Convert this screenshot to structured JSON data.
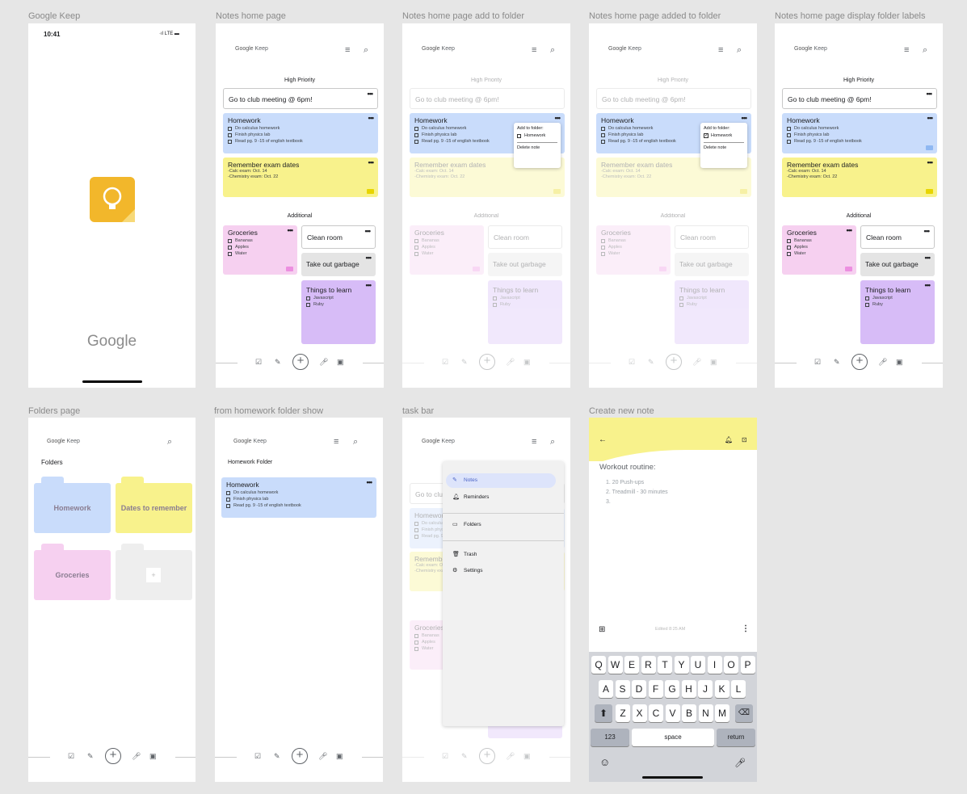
{
  "frame_labels": [
    "Google Keep",
    "Notes home page",
    "Notes home page add to folder",
    "Notes home page added to folder",
    "Notes home page display folder labels",
    "Folders page",
    "from homework folder show",
    "task bar",
    "Create new note"
  ],
  "splash": {
    "time": "10:41",
    "status": "LTE",
    "google": "Google"
  },
  "app": {
    "brand": "Google",
    "product": "Keep"
  },
  "sections": {
    "high": "High Priority",
    "additional": "Additional"
  },
  "notes": {
    "club": "Go to club meeting @ 6pm!",
    "homework_title": "Homework",
    "homework_items": [
      "Do calculus homework",
      "Finish physics lab",
      "Read pg. 9 -15 of english textbook"
    ],
    "exam_title": "Remember exam dates",
    "exam_lines": [
      "-Calc exam: Oct. 14",
      "-Chemistry exam: Oct. 22"
    ],
    "groceries_title": "Groceries",
    "groceries_items": [
      "Bananas",
      "Apples",
      "Water"
    ],
    "clean": "Clean room",
    "garbage": "Take out garbage",
    "learn_title": "Things to learn",
    "learn_items": [
      "Javascript",
      "Ruby"
    ],
    "more": "•••"
  },
  "popup": {
    "add": "Add to folder:",
    "folder": "Homework",
    "delete": "Delete note"
  },
  "folders": {
    "title": "Folders",
    "items": [
      "Homework",
      "Dates to remember",
      "Groceries"
    ],
    "add": "+"
  },
  "homework_folder": {
    "title": "Homework Folder"
  },
  "menu": {
    "items": [
      "Notes",
      "Reminders",
      "Folders",
      "Trash",
      "Settings"
    ]
  },
  "create": {
    "title": "Workout routine:",
    "lines": [
      "1. 20 Push-ups",
      "2. Treadmill - 30 minutes",
      "3."
    ],
    "edited": "Edited 8:25 AM"
  },
  "keyboard": {
    "row1": [
      "Q",
      "W",
      "E",
      "R",
      "T",
      "Y",
      "U",
      "I",
      "O",
      "P"
    ],
    "row2": [
      "A",
      "S",
      "D",
      "F",
      "G",
      "H",
      "J",
      "K",
      "L"
    ],
    "row3": [
      "Z",
      "X",
      "C",
      "V",
      "B",
      "N",
      "M"
    ],
    "num": "123",
    "space": "space",
    "return": "return"
  },
  "icons": [
    "hamburger-icon",
    "search-icon",
    "checkbox-icon",
    "brush-icon",
    "add-circle-icon",
    "mic-icon",
    "image-icon",
    "folder-icon",
    "back-arrow-icon",
    "bell-icon",
    "archive-icon",
    "backspace-icon",
    "shift-icon",
    "emoji-icon",
    "pencil-icon",
    "trash-icon",
    "settings-icon",
    "keep-logo"
  ],
  "colors": {
    "blue": "#c9dcfb",
    "yellow": "#f8f28c",
    "pink": "#f6d0f0",
    "grey": "#e4e4e4",
    "purple": "#d7bcf7",
    "accent": "#4285f4"
  }
}
